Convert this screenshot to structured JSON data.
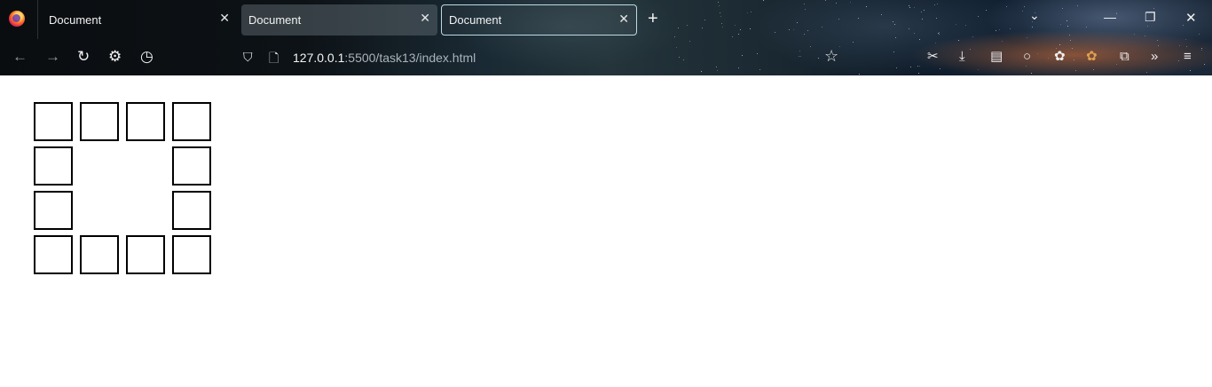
{
  "browser": {
    "tabs": [
      {
        "title": "Document",
        "close_icon": "close-icon"
      },
      {
        "title": "Document",
        "close_icon": "close-icon"
      },
      {
        "title": "Document",
        "close_icon": "close-icon",
        "active": true
      }
    ],
    "new_tab_symbol": "+",
    "url": {
      "host": "127.0.0.1",
      "rest": ":5500/task13/index.html"
    },
    "icons": {
      "back": "←",
      "forward": "→",
      "reload": "↻",
      "settings": "⚙",
      "history": "◷",
      "shield": "⛉",
      "page": "🗋",
      "star": "☆",
      "screenshot": "✂",
      "download": "⤓",
      "sidebar": "▤",
      "circle": "○",
      "cookie": "✿",
      "extension1": "✿",
      "extensions": "⧉",
      "overflow": "»",
      "menu": "≡",
      "list_all_tabs": "⌄",
      "minimize": "—",
      "maximize": "❐",
      "close": "✕",
      "tab_close": "✕"
    }
  },
  "page": {
    "grid": {
      "rows": 4,
      "cols": 4,
      "cells": [
        [
          1,
          1,
          1,
          1
        ],
        [
          1,
          0,
          0,
          1
        ],
        [
          1,
          0,
          0,
          1
        ],
        [
          1,
          1,
          1,
          1
        ]
      ]
    }
  }
}
